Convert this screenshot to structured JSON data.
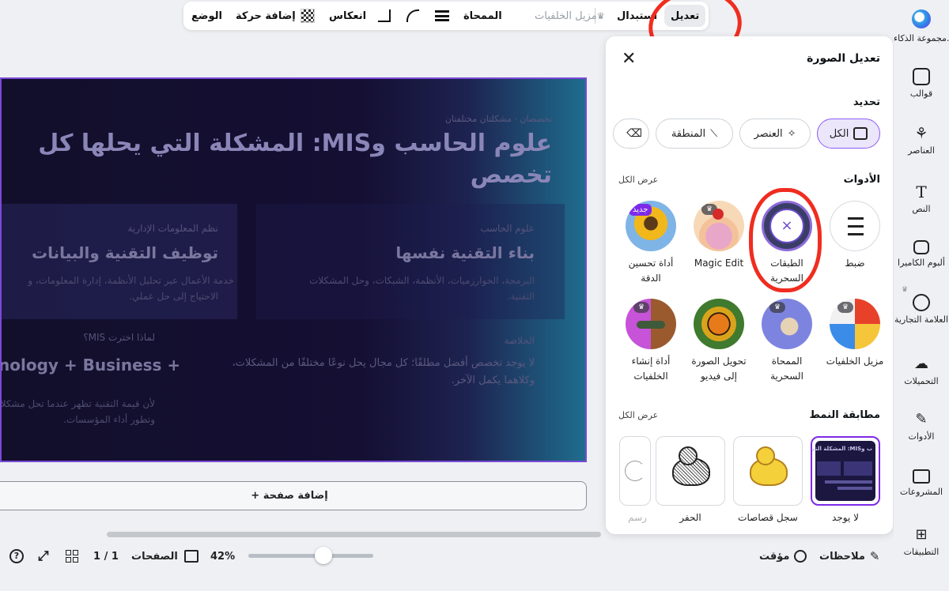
{
  "toolbar": {
    "edit": "تعديل",
    "replace": "استبدال",
    "bg_remover": "مزيل الخلفيات",
    "eraser": "الممحاة",
    "flip": "انعكاس",
    "add_animation": "إضافة حركة",
    "position": "الوضع"
  },
  "sidebar": {
    "ai_group": "مجموعة الذكاء...",
    "templates": "قوالب",
    "elements": "العناصر",
    "text": "النص",
    "camera": "ألبوم الكاميرا",
    "brand": "العلامة التجارية",
    "uploads": "التحميلات",
    "tools": "الأدوات",
    "projects": "المشروعات",
    "apps": "التطبيقات"
  },
  "slide": {
    "kicker": "تخصصان · مشكلتان مختلفتان",
    "title_line1": "علوم الحاسب وMIS: المشكلة التي يحلها كل",
    "title_line2": "تخصص",
    "cs_label": "علوم الحاسب",
    "cs_heading": "بناء التقنية نفسها",
    "cs_body_1": "البرمجة، الخوارزميات، الأنظمة، الشبكات، وحل المشكلات",
    "cs_body_2": "التقنية.",
    "mis_label": "نظم المعلومات الإدارية",
    "mis_heading": "توظيف التقنية والبيانات",
    "mis_body_1": "خدمة الأعمال عبر تحليل الأنظمة، إدارة المعلومات، و",
    "mis_body_2": "الاحتياج إلى حل عملي.",
    "summary_label": "الخلاصة",
    "summary_body_1": "لا يوجد تخصص أفضل مطلقًا؛ كل مجال يحل نوعًا مختلفًا من المشكلات،",
    "summary_body_2": "وكلاهما يكمل الآخر.",
    "why_label": "لماذا اخترت MIS؟",
    "why_heading": "nology + Business +",
    "why_body_1": "لأن قيمة التقنية تظهر عندما تحل مشكلا",
    "why_body_2": "وتطور أداء المؤسسات."
  },
  "canvas": {
    "add_page": "+ إضافة صفحة"
  },
  "bottom": {
    "notes": "ملاحظات",
    "timer": "مؤقت",
    "zoom": "42%",
    "zoom_level": 0.42,
    "pages": "الصفحات",
    "page_count": "1 / 1"
  },
  "panel": {
    "title": "تعديل الصورة",
    "select_heading": "تحديد",
    "select_all": "الكل",
    "select_element": "العنصر",
    "select_area": "المنطقة",
    "tools_heading": "الأدوات",
    "view_all": "عرض الكل",
    "tools": [
      "ضبط",
      "الطبقات السحرية",
      "Magic Edit",
      "أداة تحسين الدقة",
      "مزيل الخلفيات",
      "الممحاة السحرية",
      "تحويل الصورة إلى فيديو",
      "أداة إنشاء الخلفيات"
    ],
    "new_badge": "جديد",
    "style_heading": "مطابقة النمط",
    "styles": [
      "لا يوجد",
      "سجل قصاصات",
      "الحفر",
      "رسم"
    ],
    "thumb_title": "ب وMIS: المشكلة التي يحل"
  },
  "colors": {
    "accent": "#7d2ae8",
    "annotation_red": "#ef2d20"
  }
}
